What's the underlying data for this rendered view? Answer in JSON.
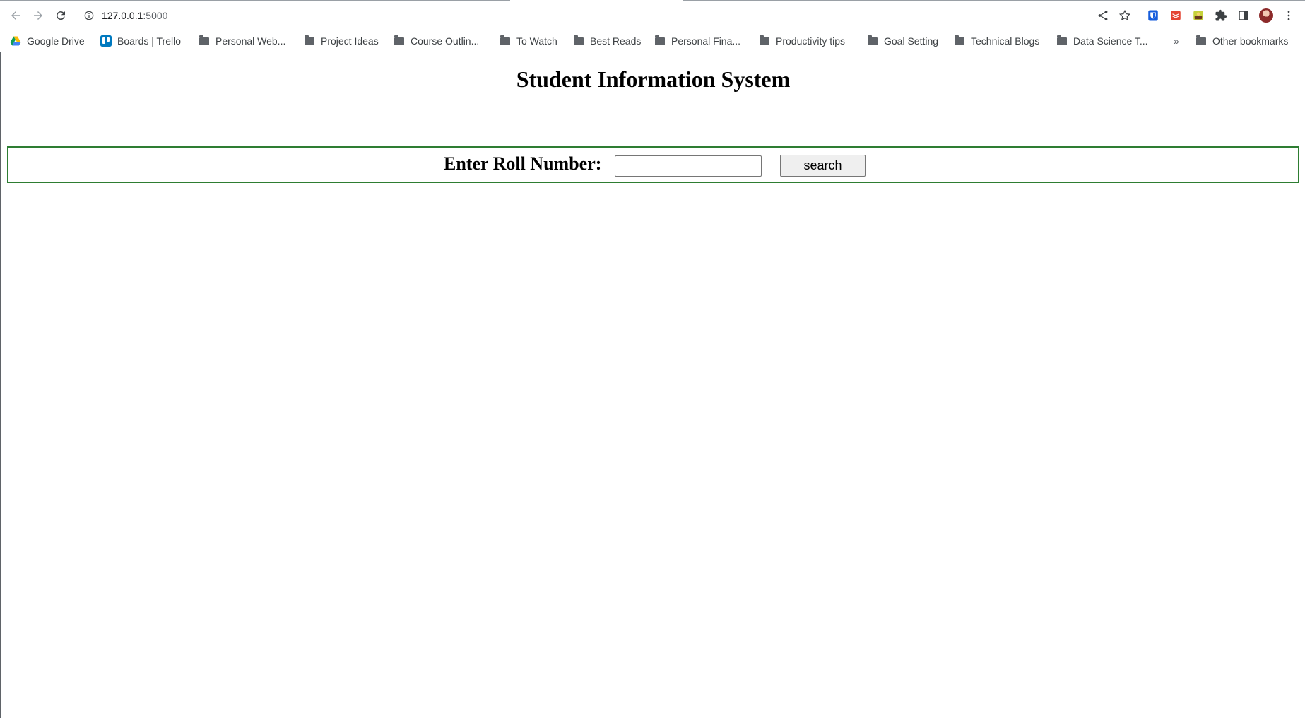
{
  "browser": {
    "url_host": "127.0.0.1",
    "url_port": ":5000",
    "bookmarks": [
      {
        "label": "Google Drive",
        "icon": "google-drive-icon"
      },
      {
        "label": "Boards | Trello",
        "icon": "trello-icon"
      },
      {
        "label": "Personal Web...",
        "icon": "folder-icon"
      },
      {
        "label": "Project Ideas",
        "icon": "folder-icon"
      },
      {
        "label": "Course Outlin...",
        "icon": "folder-icon"
      },
      {
        "label": "To Watch",
        "icon": "folder-icon"
      },
      {
        "label": "Best Reads",
        "icon": "folder-icon"
      },
      {
        "label": "Personal Fina...",
        "icon": "folder-icon"
      },
      {
        "label": "Productivity tips",
        "icon": "folder-icon"
      },
      {
        "label": "Goal Setting",
        "icon": "folder-icon"
      },
      {
        "label": "Technical Blogs",
        "icon": "folder-icon"
      },
      {
        "label": "Data Science T...",
        "icon": "folder-icon"
      }
    ],
    "overflow_chevron": "»",
    "other_bookmarks": "Other bookmarks"
  },
  "page": {
    "title": "Student Information System",
    "roll_label": "Enter Roll Number:",
    "roll_value": "",
    "search_button": "search"
  },
  "colors": {
    "search_box_border": "#2e7d32",
    "button_bg": "#efefef"
  }
}
